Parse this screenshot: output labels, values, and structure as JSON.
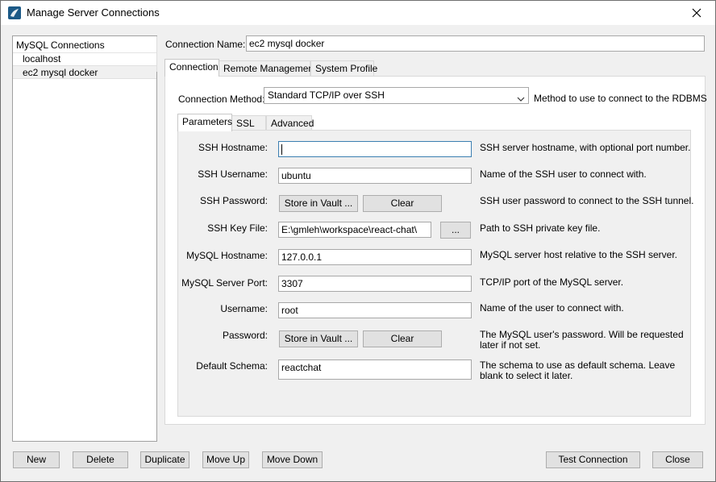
{
  "window": {
    "title": "Manage Server Connections"
  },
  "connections": {
    "header": "MySQL Connections",
    "items": [
      {
        "label": "localhost"
      },
      {
        "label": "ec2 mysql docker"
      }
    ]
  },
  "connection_name": {
    "label": "Connection Name:",
    "value": "ec2 mysql docker"
  },
  "tabs": [
    {
      "label": "Connection"
    },
    {
      "label": "Remote Management"
    },
    {
      "label": "System Profile"
    }
  ],
  "method": {
    "label": "Connection Method:",
    "value": "Standard TCP/IP over SSH",
    "description": "Method to use to connect to the RDBMS"
  },
  "subtabs": [
    {
      "label": "Parameters"
    },
    {
      "label": "SSL"
    },
    {
      "label": "Advanced"
    }
  ],
  "params": {
    "ssh_hostname": {
      "label": "SSH Hostname:",
      "value": "",
      "description": "SSH server hostname, with  optional port number."
    },
    "ssh_username": {
      "label": "SSH Username:",
      "value": "ubuntu",
      "description": "Name of the SSH user to connect with."
    },
    "ssh_password": {
      "label": "SSH Password:",
      "store_label": "Store in Vault ...",
      "clear_label": "Clear",
      "description": "SSH user password to connect to the SSH tunnel."
    },
    "ssh_key_file": {
      "label": "SSH Key File:",
      "value": "E:\\gmleh\\workspace\\react-chat\\",
      "browse_label": "...",
      "description": "Path to SSH private key file."
    },
    "mysql_hostname": {
      "label": "MySQL Hostname:",
      "value": "127.0.0.1",
      "description": "MySQL server host relative to the SSH server."
    },
    "mysql_port": {
      "label": "MySQL Server Port:",
      "value": "3307",
      "description": "TCP/IP port of the MySQL server."
    },
    "username": {
      "label": "Username:",
      "value": "root",
      "description": "Name of the user to connect with."
    },
    "password": {
      "label": "Password:",
      "store_label": "Store in Vault ...",
      "clear_label": "Clear",
      "description_1": "The MySQL user's password. Will be requested",
      "description_2": "later if not set."
    },
    "default_schema": {
      "label": "Default Schema:",
      "value": "reactchat",
      "description_1": "The schema to use as default schema. Leave",
      "description_2": "blank to select it later."
    }
  },
  "footer": {
    "new": "New",
    "delete": "Delete",
    "duplicate": "Duplicate",
    "move_up": "Move Up",
    "move_down": "Move Down",
    "test_connection": "Test Connection",
    "close": "Close"
  }
}
